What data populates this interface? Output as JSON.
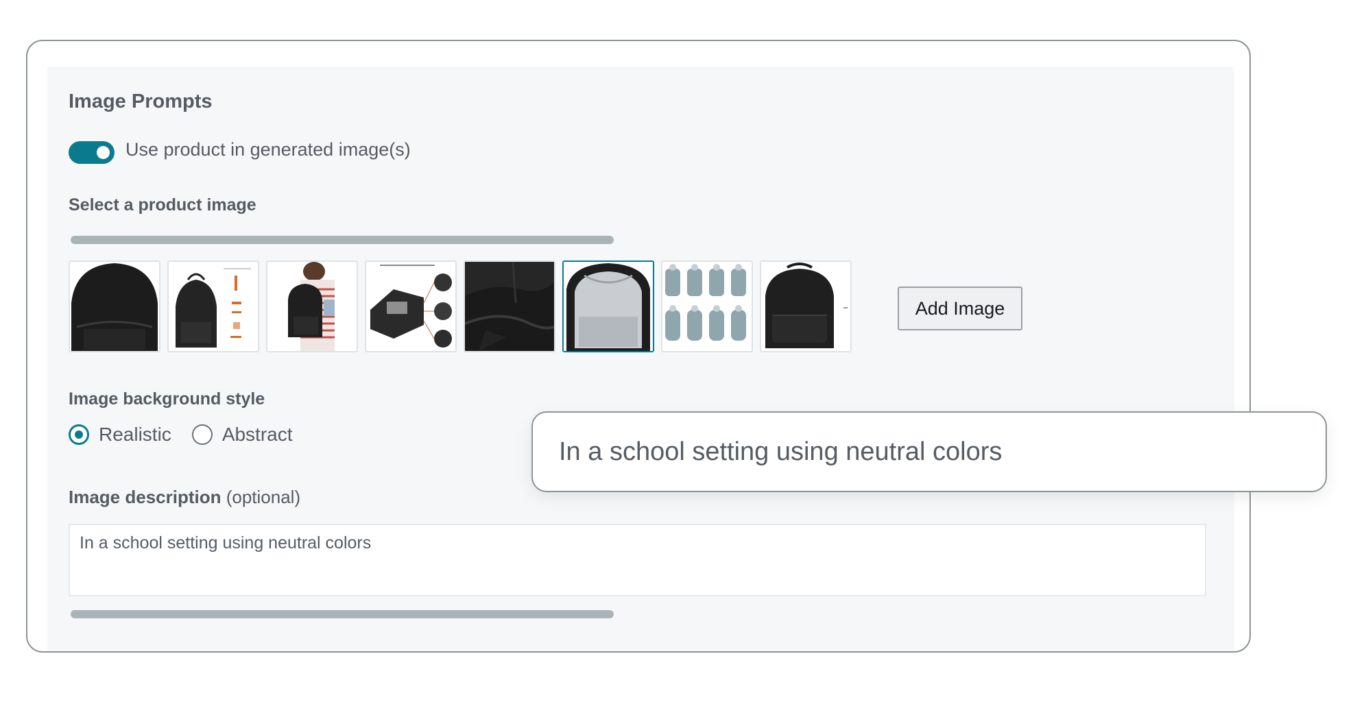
{
  "section": {
    "title": "Image Prompts",
    "toggle_label": "Use product in generated image(s)",
    "toggle_on": true
  },
  "product_images": {
    "label": "Select a product image",
    "thumbnails": [
      {
        "icon": "backpack-front-closeup-image",
        "selected": false
      },
      {
        "icon": "backpack-with-dimensions-image",
        "selected": false
      },
      {
        "icon": "person-wearing-backpack-image",
        "selected": false
      },
      {
        "icon": "backpack-features-diagram-image",
        "selected": false
      },
      {
        "icon": "backpack-fabric-closeup-image",
        "selected": false
      },
      {
        "icon": "backpack-open-interior-image",
        "selected": true
      },
      {
        "icon": "backpack-size-comparison-image",
        "selected": false
      },
      {
        "icon": "backpack-full-front-image",
        "selected": false
      }
    ],
    "add_button_label": "Add Image"
  },
  "background_style": {
    "label": "Image background style",
    "options": [
      {
        "label": "Realistic",
        "checked": true
      },
      {
        "label": "Abstract",
        "checked": false
      }
    ]
  },
  "description": {
    "label_bold": "Image description",
    "label_suffix": " (optional)",
    "value": "In a school setting using neutral colors"
  },
  "callout": {
    "text": "In a school setting using neutral colors"
  },
  "colors": {
    "accent": "#0a7b8f",
    "text": "#545b64",
    "panel": "#f6f7f8"
  }
}
